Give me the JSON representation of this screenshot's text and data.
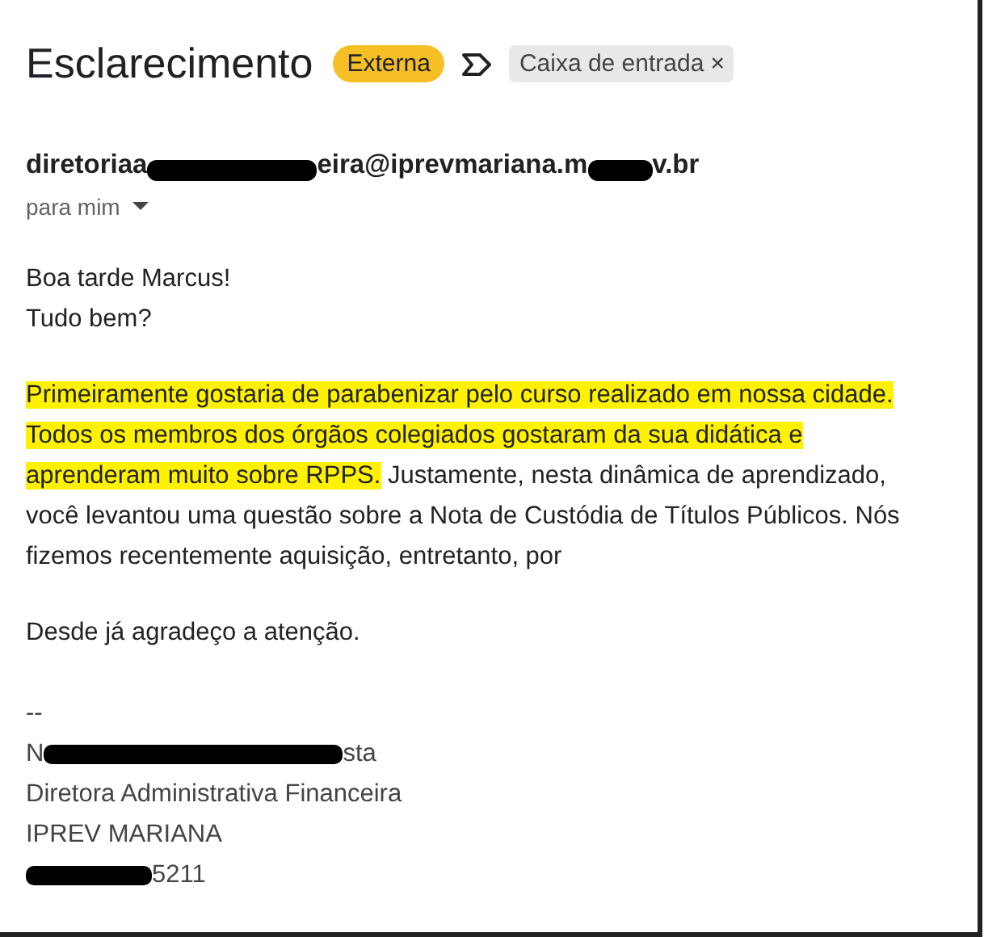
{
  "subject": "Esclarecimento",
  "badge": "Externa",
  "label_chip": {
    "text": "Caixa de entrada",
    "close": "×"
  },
  "sender": [
    {
      "kind": "text",
      "text": "diretoriaa"
    },
    {
      "kind": "redaction"
    },
    {
      "kind": "text",
      "text": "eira@iprevmariana.m"
    },
    {
      "kind": "redaction"
    },
    {
      "kind": "text",
      "text": "v.br"
    }
  ],
  "recipient": "para mim",
  "greeting": [
    "Boa tarde Marcus!",
    "Tudo bem?"
  ],
  "paragraph": {
    "highlight": "Primeiramente gostaria de parabenizar pelo curso realizado em nossa cidade. Todos os membros dos órgãos colegiados gostaram da sua didática e aprenderam muito sobre RPPS.",
    "text": " Justamente, nesta dinâmica de aprendizado, você levantou uma questão sobre a Nota de Custódia de Títulos Públicos. Nós fizemos recentemente aquisição, entretanto, por"
  },
  "closing": "Desde já agradeço a atenção.",
  "signature": [
    [
      {
        "kind": "text",
        "text": "--"
      }
    ],
    [
      {
        "kind": "text",
        "text": "N"
      },
      {
        "kind": "redaction"
      },
      {
        "kind": "text",
        "text": "sta"
      }
    ],
    [
      {
        "kind": "text",
        "text": "Diretora Administrativa Financeira"
      }
    ],
    [
      {
        "kind": "text",
        "text": "IPREV MARIANA"
      }
    ],
    [
      {
        "kind": "redaction"
      },
      {
        "kind": "text",
        "text": "5211"
      }
    ]
  ]
}
